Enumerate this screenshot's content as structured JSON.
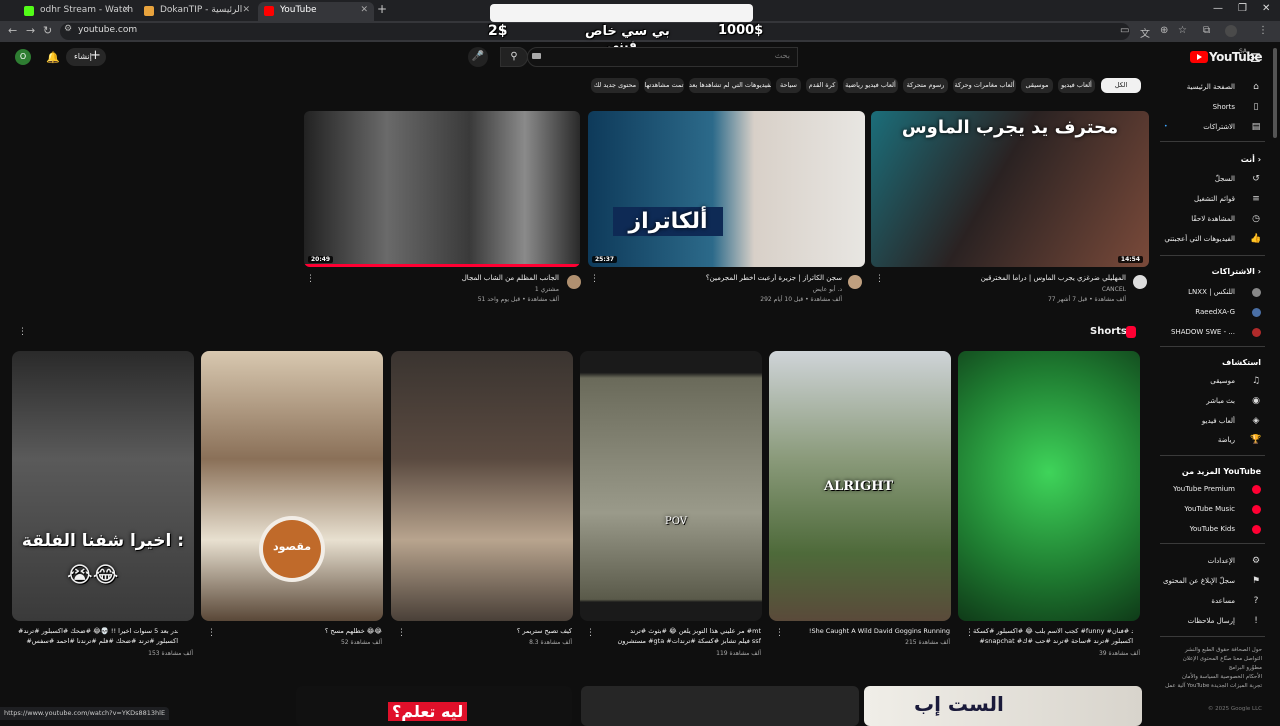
{
  "browser": {
    "tabs": [
      {
        "title": "odhr Stream - Watch Live on K",
        "color": "#53fc18"
      },
      {
        "title": "DokanTIP - الرئيسية",
        "color": "#e8a33d"
      },
      {
        "title": "YouTube",
        "color": "#ff0000"
      }
    ],
    "url": "youtube.com",
    "status_url": "https://www.youtube.com/watch?v=YKDs8813hlE"
  },
  "overlay": {
    "amount_left": "2$",
    "amount_right": "1000$",
    "message_line1": "بي سي خاص",
    "message_line2": "فيني"
  },
  "masthead": {
    "logo": "YouTube",
    "country": "SA",
    "search_placeholder": "بحث",
    "create_label": "إنشاء",
    "avatar_letter": "O"
  },
  "chips": [
    {
      "label": "الكل",
      "selected": true
    },
    {
      "label": "ألعاب فيديو"
    },
    {
      "label": "موسيقى"
    },
    {
      "label": "ألعاب مغامرات وحركة"
    },
    {
      "label": "رسوم متحركة"
    },
    {
      "label": "ألعاب فيديو رياضية"
    },
    {
      "label": "كرة القدم"
    },
    {
      "label": "سياحة"
    },
    {
      "label": "الفيديوهات التي لم تشاهدها بعد"
    },
    {
      "label": "تمت مشاهدتها"
    },
    {
      "label": "محتوى جديد لك"
    }
  ],
  "sidebar": {
    "main": [
      {
        "label": "الصفحة الرئيسية",
        "icon": "home-icon",
        "glyph": "⌂"
      },
      {
        "label": "Shorts",
        "icon": "shorts-icon",
        "glyph": "▯"
      },
      {
        "label": "الاشتراكات",
        "icon": "subscriptions-icon",
        "glyph": "▤"
      }
    ],
    "you_heading": "أنت",
    "you": [
      {
        "label": "السجلّ",
        "icon": "history-icon",
        "glyph": "↺"
      },
      {
        "label": "قوائم التشغيل",
        "icon": "playlists-icon",
        "glyph": "≡"
      },
      {
        "label": "المشاهدة لاحقًا",
        "icon": "watch-later-icon",
        "glyph": "◷"
      },
      {
        "label": "الفيديوهات التي أعجبتني",
        "icon": "like-icon",
        "glyph": "👍"
      }
    ],
    "subs_heading": "الاشتراكات",
    "subs": [
      {
        "label": "LNXX | اللنكس",
        "color": "#888888"
      },
      {
        "label": "RaeedXA-G",
        "color": "#4a6fa5"
      },
      {
        "label": "SHADOW SWE - ...",
        "color": "#b02a2a"
      }
    ],
    "explore_heading": "استكشاف",
    "explore": [
      {
        "label": "موسيقى",
        "icon": "music-icon",
        "glyph": "♫"
      },
      {
        "label": "بث مباشر",
        "icon": "live-icon",
        "glyph": "◉"
      },
      {
        "label": "ألعاب فيديو",
        "icon": "gaming-icon",
        "glyph": "◈"
      },
      {
        "label": "رياضة",
        "icon": "trophy-icon",
        "glyph": "🏆"
      }
    ],
    "more_heading": "المزيد من YouTube",
    "more": [
      {
        "label": "YouTube Premium"
      },
      {
        "label": "YouTube Music"
      },
      {
        "label": "YouTube Kids"
      }
    ],
    "settings": [
      {
        "label": "الإعدادات",
        "icon": "settings-icon",
        "glyph": "⚙"
      },
      {
        "label": "سجلّ الإبلاغ عن المحتوى",
        "icon": "flag-icon",
        "glyph": "⚑"
      },
      {
        "label": "مساعدة",
        "icon": "help-icon",
        "glyph": "?"
      },
      {
        "label": "إرسال ملاحظات",
        "icon": "feedback-icon",
        "glyph": "!"
      }
    ],
    "footer_lines": [
      "حول  الصحافة  حقوق الطبع والنشر",
      "التواصل معنا  صنّاع المحتوى  الإعلان",
      "مطوّرو البرامج",
      "الأحكام  الخصوصية  السياسة والأمان",
      "آلية عمل YouTube  تجربة الميزات الجديدة"
    ],
    "copyright": "© 2025 Google LLC"
  },
  "videos": [
    {
      "title": "المهليلي ضرغزي يجرب الماوس | دراما المخترقين",
      "channel": "CANCEL",
      "views": "77 ألف مشاهدة • قبل 7 أشهر",
      "duration": "14:54",
      "overlay_text": "محترف يد يجرب الماوس",
      "bg": "#3b2e2a",
      "chcolor": "#dddddd"
    },
    {
      "title": "سجن الكاتراز | جزيرة أرعبت أخطر المجرمين؟",
      "channel": "د. أبو عايض",
      "views": "292 ألف مشاهدة • قبل 10 أيام",
      "duration": "25:37",
      "overlay_text": "ألكاتراز",
      "bg": "#1f5a7a",
      "chcolor": "#c0a080"
    },
    {
      "title": "الجانب المظلم من الشاب المجال",
      "channel": "مشتري 1",
      "views": "51 ألف مشاهدة • قبل يوم واحد",
      "duration": "20:49",
      "overlay_text": "",
      "bg": "#3a3a3a",
      "chcolor": "#b09070"
    }
  ],
  "shorts_heading": "Shorts",
  "shorts": [
    {
      "title": "كجب الاسم بلب 😂 #اكسبلور #كسكة #funny #ترند #مرد #فنان",
      "title2": "#snapchat #اكسبلور #ترند #ساحة #ترند #حب #ك",
      "views": "39 ألف مشاهدة",
      "bg": "#2e8b3e"
    },
    {
      "title": "!She Caught A Wild David Goggins Running",
      "title2": "",
      "views": "215 ألف مشاهدة",
      "bg": "#6b7a5a",
      "overlay": "ALRIGHT"
    },
    {
      "title": "مر عليني هذا التوبز يلعن 😂 #بثوث #ترند #mt",
      "title2": "مستشرون #gta #فيلم تشابز #كسكة #ترندات ssf",
      "views": "119 ألف مشاهدة",
      "bg": "#5a5a52",
      "overlay": "POV"
    },
    {
      "title": "كيف تصبح ستريمر ؟",
      "title2": "",
      "views": "8.3 ألف مشاهدة",
      "bg": "#4a4038"
    },
    {
      "title": "خطلهم مسح ؟ 😂😂",
      "title2": "",
      "views": "52 ألف مشاهدة",
      "bg": "#6a5a48",
      "overlay": "مقصود"
    },
    {
      "title": "#جدر بعد 5 سنوات اخيرا !! 💀😂 #ضحك #اكسبلور #ترند",
      "title2": "#اكسبلور #ترند #ضحك #فلم #ترندنا #احمد #سفس",
      "views": "153 ألف مشاهدة",
      "bg": "#3a3a3a",
      "overlay": "اخيرا شفنا الفلقة :"
    }
  ]
}
